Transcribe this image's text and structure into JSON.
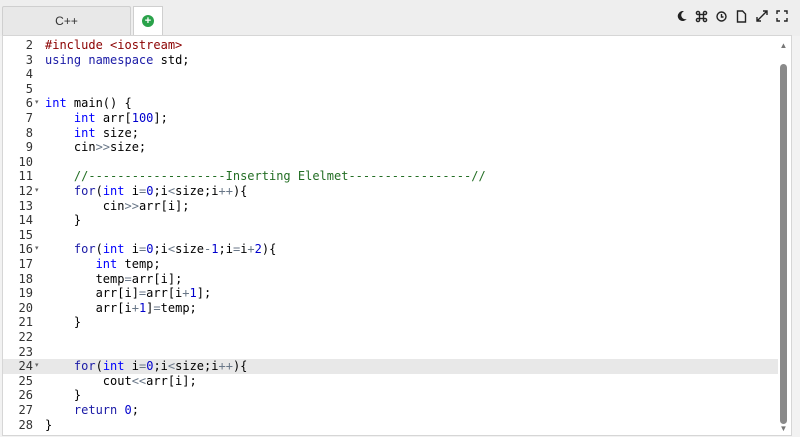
{
  "tabs": {
    "language_label": "C++",
    "add_label": "+"
  },
  "toolbar": {
    "icons": [
      "moon-icon",
      "command-icon",
      "history-icon",
      "file-icon",
      "expand-icon",
      "fullscreen-icon"
    ]
  },
  "editor": {
    "active_line": 24,
    "folded_lines": [
      6,
      12,
      16,
      24
    ],
    "lines": [
      {
        "n": "2",
        "text": "#include <iostream>"
      },
      {
        "n": "3",
        "text": "using namespace std;"
      },
      {
        "n": "4",
        "text": ""
      },
      {
        "n": "5",
        "text": ""
      },
      {
        "n": "6",
        "text": "int main() {"
      },
      {
        "n": "7",
        "text": "    int arr[100];"
      },
      {
        "n": "8",
        "text": "    int size;"
      },
      {
        "n": "9",
        "text": "    cin>>size;"
      },
      {
        "n": "10",
        "text": ""
      },
      {
        "n": "11",
        "text": "    //-------------------Inserting Elelmet-----------------//"
      },
      {
        "n": "12",
        "text": "    for(int i=0;i<size;i++){"
      },
      {
        "n": "13",
        "text": "        cin>>arr[i];"
      },
      {
        "n": "14",
        "text": "    }"
      },
      {
        "n": "15",
        "text": ""
      },
      {
        "n": "16",
        "text": "    for(int i=0;i<size-1;i=i+2){"
      },
      {
        "n": "17",
        "text": "       int temp;"
      },
      {
        "n": "18",
        "text": "       temp=arr[i];"
      },
      {
        "n": "19",
        "text": "       arr[i]=arr[i+1];"
      },
      {
        "n": "20",
        "text": "       arr[i+1]=temp;"
      },
      {
        "n": "21",
        "text": "    }"
      },
      {
        "n": "22",
        "text": ""
      },
      {
        "n": "23",
        "text": ""
      },
      {
        "n": "24",
        "text": "    for(int i=0;i<size;i++){"
      },
      {
        "n": "25",
        "text": "        cout<<arr[i];"
      },
      {
        "n": "26",
        "text": "    }"
      },
      {
        "n": "27",
        "text": "    return 0;"
      },
      {
        "n": "28",
        "text": "}"
      }
    ]
  },
  "colors": {
    "keyword": "#1a1aa6",
    "type": "#0000ff",
    "number": "#0000cd",
    "operator": "#687687",
    "comment": "#236e24",
    "preprocessor": "#8b0000",
    "active_line": "#e8e8e8",
    "add_button": "#2aa24a"
  }
}
